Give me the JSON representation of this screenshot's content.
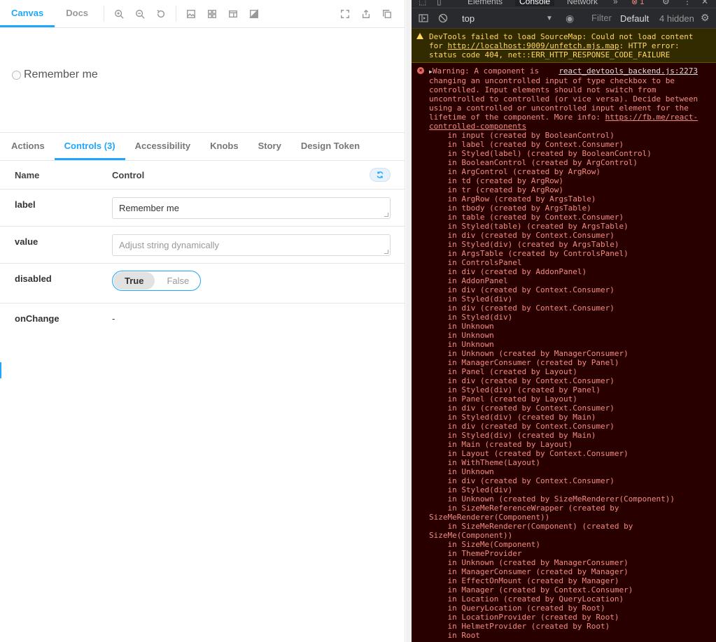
{
  "toolbar": {
    "tabs": [
      "Canvas",
      "Docs"
    ],
    "active_tab": "Canvas"
  },
  "preview": {
    "checkbox_label": "Remember me"
  },
  "addons": {
    "tabs": [
      "Actions",
      "Controls (3)",
      "Accessibility",
      "Knobs",
      "Story",
      "Design Token"
    ],
    "active_tab": "Controls (3)"
  },
  "args_table": {
    "header_name": "Name",
    "header_control": "Control",
    "rows": [
      {
        "name": "label",
        "value": "Remember me"
      },
      {
        "name": "value",
        "placeholder": "Adjust string dynamically"
      },
      {
        "name": "disabled",
        "options": [
          "True",
          "False"
        ],
        "selected": "True"
      },
      {
        "name": "onChange",
        "value": "-"
      }
    ]
  },
  "devtools": {
    "tabs": [
      "Elements",
      "Console",
      "Network"
    ],
    "active_tab": "Console",
    "more": "»",
    "error_count": "1",
    "context": "top",
    "filter_placeholder": "Filter",
    "levels": "Default",
    "hidden": "4 hidden",
    "warning": {
      "text_before": "DevTools failed to load SourceMap: Could not load content for ",
      "link": "http://localhost:9009/unfetch.mjs.map",
      "text_after": ": HTTP error: status code 404, net::ERR_HTTP_RESPONSE_CODE_FAILURE"
    },
    "error": {
      "source": "react_devtools_backend.js:2273",
      "line1": "Warning: A component is",
      "message": "changing an uncontrolled input of type checkbox to be\ncontrolled. Input elements should not switch from\nuncontrolled to controlled (or vice versa). Decide between\nusing a controlled or uncontrolled input element for the\nlifetime of the component. More info: ",
      "link_a": "https://fb.me/react-",
      "link_b": "controlled-components",
      "stack": [
        "    in input (created by BooleanControl)",
        "    in label (created by Context.Consumer)",
        "    in Styled(label) (created by BooleanControl)",
        "    in BooleanControl (created by ArgControl)",
        "    in ArgControl (created by ArgRow)",
        "    in td (created by ArgRow)",
        "    in tr (created by ArgRow)",
        "    in ArgRow (created by ArgsTable)",
        "    in tbody (created by ArgsTable)",
        "    in table (created by Context.Consumer)",
        "    in Styled(table) (created by ArgsTable)",
        "    in div (created by Context.Consumer)",
        "    in Styled(div) (created by ArgsTable)",
        "    in ArgsTable (created by ControlsPanel)",
        "    in ControlsPanel",
        "    in div (created by AddonPanel)",
        "    in AddonPanel",
        "    in div (created by Context.Consumer)",
        "    in Styled(div)",
        "    in div (created by Context.Consumer)",
        "    in Styled(div)",
        "    in Unknown",
        "    in Unknown",
        "    in Unknown",
        "    in Unknown (created by ManagerConsumer)",
        "    in ManagerConsumer (created by Panel)",
        "    in Panel (created by Layout)",
        "    in div (created by Context.Consumer)",
        "    in Styled(div) (created by Panel)",
        "    in Panel (created by Layout)",
        "    in div (created by Context.Consumer)",
        "    in Styled(div) (created by Main)",
        "    in div (created by Context.Consumer)",
        "    in Styled(div) (created by Main)",
        "    in Main (created by Layout)",
        "    in Layout (created by Context.Consumer)",
        "    in WithTheme(Layout)",
        "    in Unknown",
        "    in div (created by Context.Consumer)",
        "    in Styled(div)",
        "    in Unknown (created by SizeMeRenderer(Component))",
        "    in SizeMeReferenceWrapper (created by",
        "SizeMeRenderer(Component))",
        "    in SizeMeRenderer(Component) (created by",
        "SizeMe(Component))",
        "    in SizeMe(Component)",
        "    in ThemeProvider",
        "    in Unknown (created by ManagerConsumer)",
        "    in ManagerConsumer (created by Manager)",
        "    in EffectOnMount (created by Manager)",
        "    in Manager (created by Context.Consumer)",
        "    in Location (created by QueryLocation)",
        "    in QueryLocation (created by Root)",
        "    in LocationProvider (created by Root)",
        "    in HelmetProvider (created by Root)",
        "    in Root"
      ]
    }
  }
}
